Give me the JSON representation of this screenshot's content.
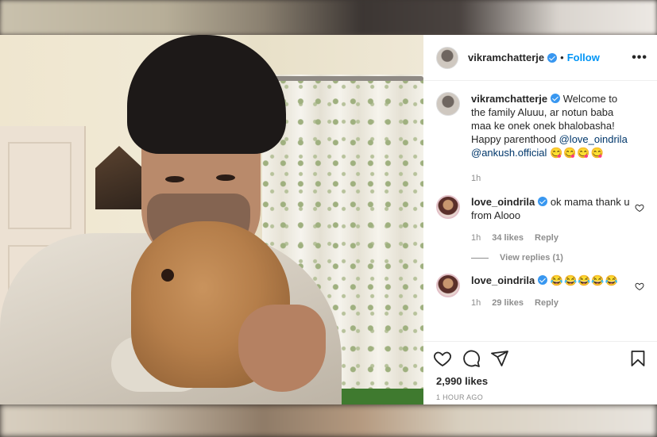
{
  "post": {
    "username": "vikramchatterje",
    "follow_label": "Follow",
    "dot": "•",
    "more_label": "•••",
    "caption": {
      "username": "vikramchatterje",
      "text": "Welcome to the family Aluuu, ar notun baba maa ke onek onek bhalobasha! Happy parenthood",
      "mention_1": "@love_oindrila",
      "mention_2": "@ankush.official",
      "emojis": "😋😋😋😋",
      "time": "1h"
    },
    "comments": [
      {
        "username": "love_oindrila",
        "text": "ok mama thank u from Alooo",
        "time": "1h",
        "likes": "34 likes",
        "reply_label": "Reply"
      },
      {
        "username": "love_oindrila",
        "text": "",
        "emojis": "😂😂😂😂😂",
        "time": "1h",
        "likes": "29 likes",
        "reply_label": "Reply"
      }
    ],
    "view_replies": "View replies (1)",
    "likes_count": "2,990 likes",
    "timestamp": "1 HOUR AGO"
  },
  "icons": {
    "like": "heart-icon",
    "comment": "comment-icon",
    "share": "share-icon",
    "save": "bookmark-icon",
    "verified": "verified-badge-icon"
  },
  "colors": {
    "link_blue": "#0095f6",
    "verified_blue": "#3897f0",
    "mention": "#00376b",
    "muted": "#8e8e8e"
  }
}
